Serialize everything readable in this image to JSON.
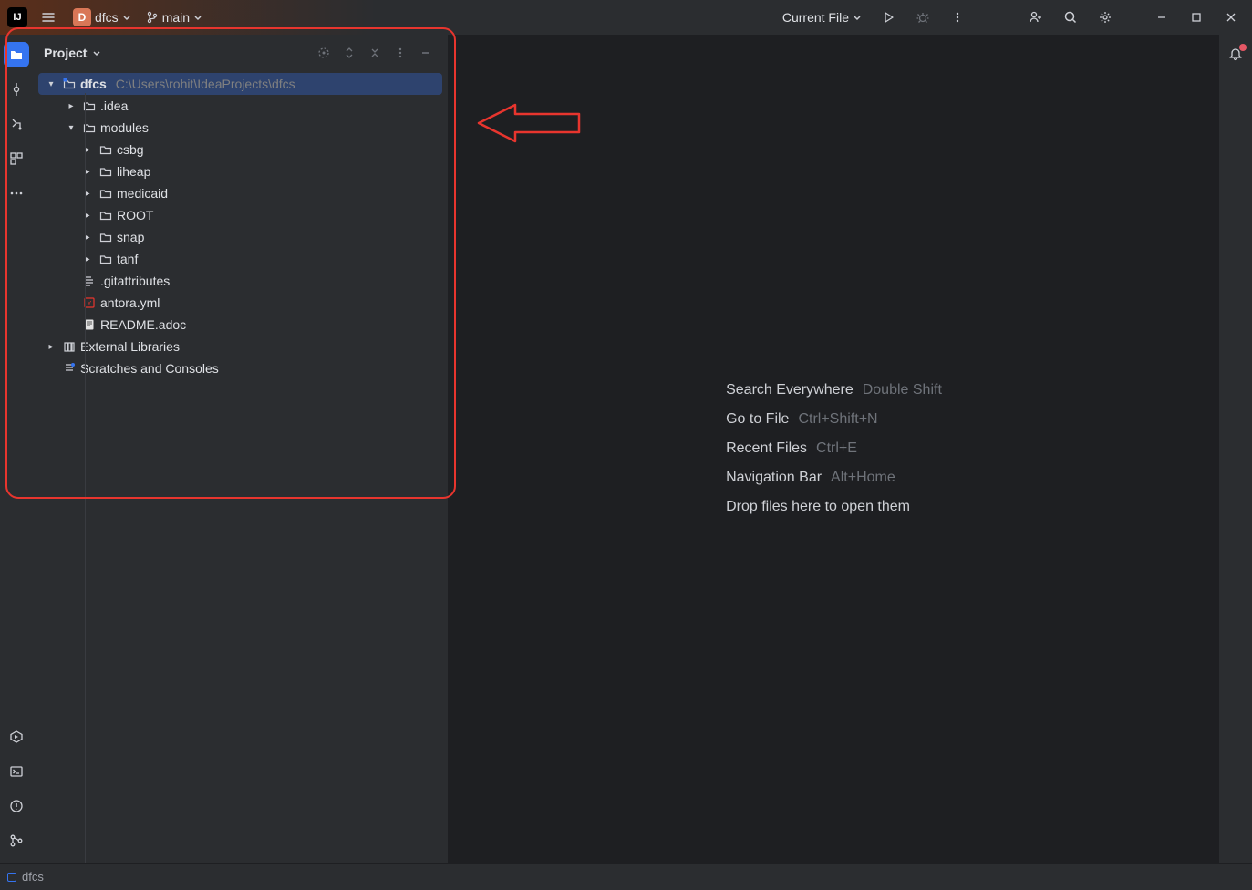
{
  "titlebar": {
    "logo_text": "IJ",
    "project_badge": "D",
    "project_name": "dfcs",
    "branch": "main",
    "run_config": "Current File"
  },
  "panel": {
    "title": "Project"
  },
  "tree": {
    "root": {
      "name": "dfcs",
      "path": "C:\\Users\\rohit\\IdeaProjects\\dfcs"
    },
    "idea": ".idea",
    "modules": "modules",
    "csbg": "csbg",
    "liheap": "liheap",
    "medicaid": "medicaid",
    "ROOT": "ROOT",
    "snap": "snap",
    "tanf": "tanf",
    "gitattributes": ".gitattributes",
    "antora": "antora.yml",
    "readme": "README.adoc",
    "ext_libs": "External Libraries",
    "scratches": "Scratches and Consoles"
  },
  "empty": {
    "search_label": "Search Everywhere",
    "search_key": "Double Shift",
    "goto_label": "Go to File",
    "goto_key": "Ctrl+Shift+N",
    "recent_label": "Recent Files",
    "recent_key": "Ctrl+E",
    "nav_label": "Navigation Bar",
    "nav_key": "Alt+Home",
    "drop": "Drop files here to open them"
  },
  "statusbar": {
    "module": "dfcs"
  }
}
